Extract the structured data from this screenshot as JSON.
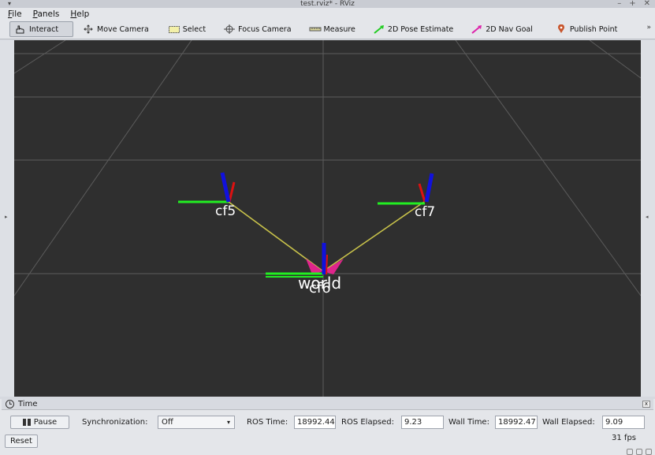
{
  "window": {
    "title": "test.rviz* - RViz",
    "menu_glyph": "▾",
    "controls": [
      "–",
      "+",
      "✕"
    ]
  },
  "menu": [
    "File",
    "Panels",
    "Help"
  ],
  "toolbar": {
    "tools": [
      {
        "label": "Interact",
        "icon": "hand-pointer-icon",
        "active": true
      },
      {
        "label": "Move Camera",
        "icon": "move-camera-icon"
      },
      {
        "label": "Select",
        "icon": "select-box-icon"
      },
      {
        "label": "Focus Camera",
        "icon": "focus-crosshair-icon"
      },
      {
        "label": "Measure",
        "icon": "ruler-icon"
      },
      {
        "label": "2D Pose Estimate",
        "icon": "green-arrow-icon"
      },
      {
        "label": "2D Nav Goal",
        "icon": "magenta-arrow-icon"
      },
      {
        "label": "Publish Point",
        "icon": "map-pin-icon"
      }
    ],
    "overflow": "»"
  },
  "scene": {
    "background": "#2f2f2f",
    "frames": [
      {
        "name": "cf5"
      },
      {
        "name": "cf7"
      },
      {
        "name": "world"
      },
      {
        "name": "cf6"
      }
    ],
    "axis_colors": {
      "x": "#dd1111",
      "y": "#22ee22",
      "z": "#1111dd"
    },
    "link_color": "#c8c24a",
    "arrow_color": "#e0248c",
    "side_arrows": {
      "left": "▸",
      "right": "◂"
    }
  },
  "time_panel": {
    "title": "Time",
    "close": "x",
    "pause_label": "Pause",
    "sync_label": "Synchronization:",
    "sync_value": "Off",
    "ros_time_label": "ROS Time:",
    "ros_time": "18992.44",
    "ros_elapsed_label": "ROS Elapsed:",
    "ros_elapsed": "9.23",
    "wall_time_label": "Wall Time:",
    "wall_time": "18992.47",
    "wall_elapsed_label": "Wall Elapsed:",
    "wall_elapsed": "9.09",
    "reset_label": "Reset",
    "fps": "31 fps"
  }
}
